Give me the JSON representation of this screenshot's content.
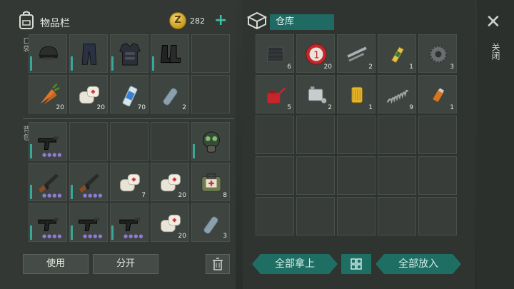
{
  "inventory": {
    "title": "物品栏",
    "coins": "282",
    "pockets_label": "口袋",
    "backpack_label": "背包",
    "pockets": [
      {
        "icon": "helmet-icon",
        "count": ""
      },
      {
        "icon": "pants-icon",
        "count": ""
      },
      {
        "icon": "armor-vest-icon",
        "count": ""
      },
      {
        "icon": "boots-icon",
        "count": ""
      },
      {
        "icon": "",
        "count": ""
      },
      {
        "icon": "carrot-icon",
        "count": "20"
      },
      {
        "icon": "bandage-icon",
        "count": "20"
      },
      {
        "icon": "spray-can-icon",
        "count": "70"
      },
      {
        "icon": "water-bottle-icon",
        "count": "2"
      },
      {
        "icon": "",
        "count": ""
      }
    ],
    "backpack": [
      {
        "icon": "smg-icon",
        "count": ""
      },
      {
        "icon": "",
        "count": ""
      },
      {
        "icon": "",
        "count": ""
      },
      {
        "icon": "",
        "count": ""
      },
      {
        "icon": "gas-mask-icon",
        "count": ""
      },
      {
        "icon": "rifle-icon",
        "count": ""
      },
      {
        "icon": "rifle-icon",
        "count": ""
      },
      {
        "icon": "bandage-icon",
        "count": "7"
      },
      {
        "icon": "bandage-icon",
        "count": "20"
      },
      {
        "icon": "medkit-bag-icon",
        "count": "8"
      },
      {
        "icon": "smg-icon",
        "count": ""
      },
      {
        "icon": "smg-icon",
        "count": ""
      },
      {
        "icon": "smg-icon",
        "count": ""
      },
      {
        "icon": "bandage-icon",
        "count": "20"
      },
      {
        "icon": "water-bottle-icon",
        "count": "3"
      }
    ],
    "use_label": "使用",
    "split_label": "分开"
  },
  "warehouse": {
    "title": "仓库",
    "items": [
      {
        "icon": "metal-plate-icon",
        "count": "6"
      },
      {
        "icon": "bottle-cap-icon",
        "count": "20"
      },
      {
        "icon": "pipe-parts-icon",
        "count": "2"
      },
      {
        "icon": "syringe-icon",
        "count": "1"
      },
      {
        "icon": "gear-icon",
        "count": "3"
      },
      {
        "icon": "oil-can-icon",
        "count": "5"
      },
      {
        "icon": "engine-block-icon",
        "count": "2"
      },
      {
        "icon": "oil-filter-icon",
        "count": "1"
      },
      {
        "icon": "spring-icon",
        "count": "9"
      },
      {
        "icon": "lighter-icon",
        "count": "1"
      }
    ],
    "take_all_label": "全部拿上",
    "put_all_label": "全部放入"
  },
  "close_label": "关闭"
}
